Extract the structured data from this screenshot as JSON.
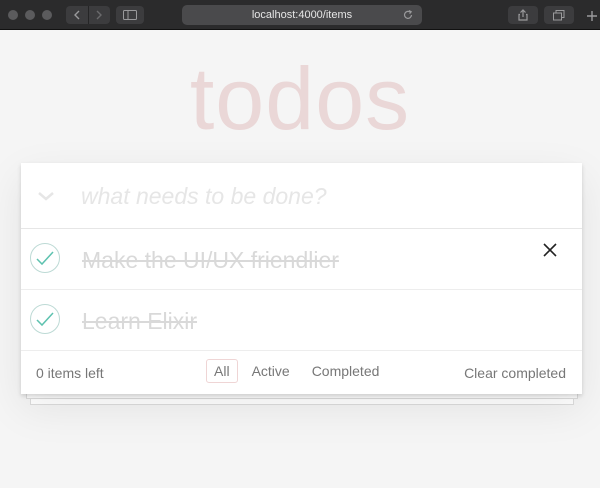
{
  "browser": {
    "url": "localhost:4000/items"
  },
  "app": {
    "title": "todos",
    "new_todo_placeholder": "what needs to be done?",
    "todos": [
      {
        "label": "Make the UI/UX friendlier",
        "completed": true
      },
      {
        "label": "Learn Elixir",
        "completed": true
      }
    ],
    "footer": {
      "count_text": "0 items left",
      "filters": [
        {
          "label": "All",
          "selected": true
        },
        {
          "label": "Active",
          "selected": false
        },
        {
          "label": "Completed",
          "selected": false
        }
      ],
      "clear_label": "Clear completed"
    }
  },
  "colors": {
    "title": "#f1d7d7",
    "check_ring": "#bddad5",
    "check_mark": "#5dc2af",
    "completed_text": "#d9d9d9",
    "chrome_bg": "#2b2b2c"
  },
  "icons": {
    "toggle_all": "chevron-down-icon",
    "check": "check-icon",
    "destroy": "close-icon"
  }
}
